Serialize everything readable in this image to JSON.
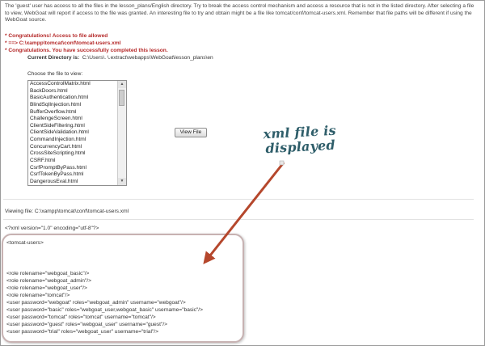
{
  "intro": "The 'guest' user has access to all the files in the lesson_plans/English directory. Try to break the access control mechanism and access a resource that is not in the listed directory. After selecting a file to view, WebGoat will report if access to the file was granted. An interesting file to try and obtain might be a file like tomcat/conf/tomcat-users.xml. Remember that file paths will be different if using the WebGoat source.",
  "messages": [
    "* Congratulations! Access to file allowed",
    "* ==> C:\\xampp\\tomcat\\conf\\tomcat-users.xml",
    "* Congratulations. You have successfully completed this lesson."
  ],
  "current_dir": {
    "label": "Current Directory is:",
    "value": "C:\\Users\\.                \\.extract\\webapps\\WebGoat\\lesson_plans\\en"
  },
  "file_chooser": {
    "label": "Choose the file to view:",
    "files": [
      "AccessControlMatrix.html",
      "BackDoors.html",
      "BasicAuthentication.html",
      "BlindSqlInjection.html",
      "BufferOverflow.html",
      "ChallengeScreen.html",
      "ClientSideFiltering.html",
      "ClientSideValidation.html",
      "CommandInjection.html",
      "ConcurrencyCart.html",
      "CrossSiteScripting.html",
      "CSRF.html",
      "CsrfPromptByPass.html",
      "CsrfTokenByPass.html",
      "DangerousEval.html"
    ]
  },
  "view_button": "View File",
  "viewing": "Viewing file: C:\\xampp\\tomcat\\conf\\tomcat-users.xml",
  "xml_decl": "<?xml version=\"1.0\" encoding=\"utf-8\"?>",
  "xml_content": {
    "root": "<tomcat-users>",
    "lines": [
      "<role rolename=\"webgoat_basic\"/>",
      "<role rolename=\"webgoat_admin\"/>",
      "<role rolename=\"webgoat_user\"/>",
      "<role rolename=\"tomcat\"/>",
      "<user password=\"webgoat\" roles=\"webgoat_admin\" username=\"webgoat\"/>",
      "<user password=\"basic\" roles=\"webgoat_user,webgoat_basic\" username=\"basic\"/>",
      "<user password=\"tomcat\" roles=\"tomcat\" username=\"tomcat\"/>",
      "<user password=\"guest\" roles=\"webgoat_user\" username=\"guest\"/>",
      "<user password=\"trial\" roles=\"webgoat_user\" username=\"trial\"/>"
    ]
  },
  "annotation": {
    "line1": "xml file is",
    "line2": "displayed",
    "text_color": "#2f5e6a",
    "arrow_color": "#b5472c"
  }
}
